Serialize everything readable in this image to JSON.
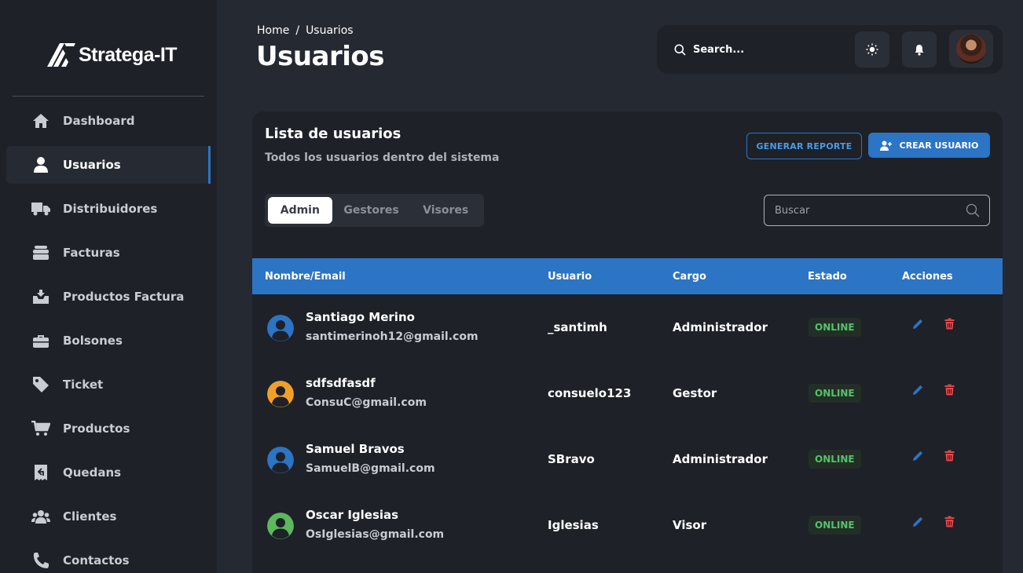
{
  "brand": {
    "name": "Stratega-IT"
  },
  "sidebar": {
    "items": [
      {
        "label": "Dashboard",
        "icon": "home-icon"
      },
      {
        "label": "Usuarios",
        "icon": "user-icon",
        "active": true
      },
      {
        "label": "Distribuidores",
        "icon": "truck-icon"
      },
      {
        "label": "Facturas",
        "icon": "stack-icon"
      },
      {
        "label": "Productos Factura",
        "icon": "inbox-download-icon"
      },
      {
        "label": "Bolsones",
        "icon": "briefcase-icon"
      },
      {
        "label": "Ticket",
        "icon": "tag-icon"
      },
      {
        "label": "Productos",
        "icon": "cart-icon"
      },
      {
        "label": "Quedans",
        "icon": "receipt-icon"
      },
      {
        "label": "Clientes",
        "icon": "users-icon"
      },
      {
        "label": "Contactos",
        "icon": "phone-icon"
      }
    ]
  },
  "header": {
    "breadcrumb": {
      "home": "Home",
      "separator": "/",
      "current": "Usuarios"
    },
    "title": "Usuarios",
    "search_placeholder": "Search..."
  },
  "card": {
    "title": "Lista de usuarios",
    "subtitle": "Todos los usuarios dentro del sistema",
    "report_button": "GENERAR REPORTE",
    "create_button": "CREAR USUARIO",
    "tabs": [
      "Admin",
      "Gestores",
      "Visores"
    ],
    "active_tab": 0,
    "filter_placeholder": "Buscar"
  },
  "table": {
    "columns": [
      "Nombre/Email",
      "Usuario",
      "Cargo",
      "Estado",
      "Acciones"
    ],
    "rows": [
      {
        "name": "Santiago Merino",
        "email": "santimerinoh12@gmail.com",
        "usuario": "_santimh",
        "cargo": "Administrador",
        "estado": "ONLINE",
        "avatar_color": "#2c74c4"
      },
      {
        "name": "sdfsdfasdf",
        "email": "ConsuC@gmail.com",
        "usuario": "consuelo123",
        "cargo": "Gestor",
        "estado": "ONLINE",
        "avatar_color": "#f0a02a"
      },
      {
        "name": "Samuel Bravos",
        "email": "SamuelB@gmail.com",
        "usuario": "SBravo",
        "cargo": "Administrador",
        "estado": "ONLINE",
        "avatar_color": "#2c74c4"
      },
      {
        "name": "Oscar Iglesias",
        "email": "OsIglesias@gmail.com",
        "usuario": "Iglesias",
        "cargo": "Visor",
        "estado": "ONLINE",
        "avatar_color": "#5cb85c"
      }
    ]
  },
  "colors": {
    "accent": "#2c74c4",
    "online": "#55c26b",
    "danger": "#e04848"
  }
}
